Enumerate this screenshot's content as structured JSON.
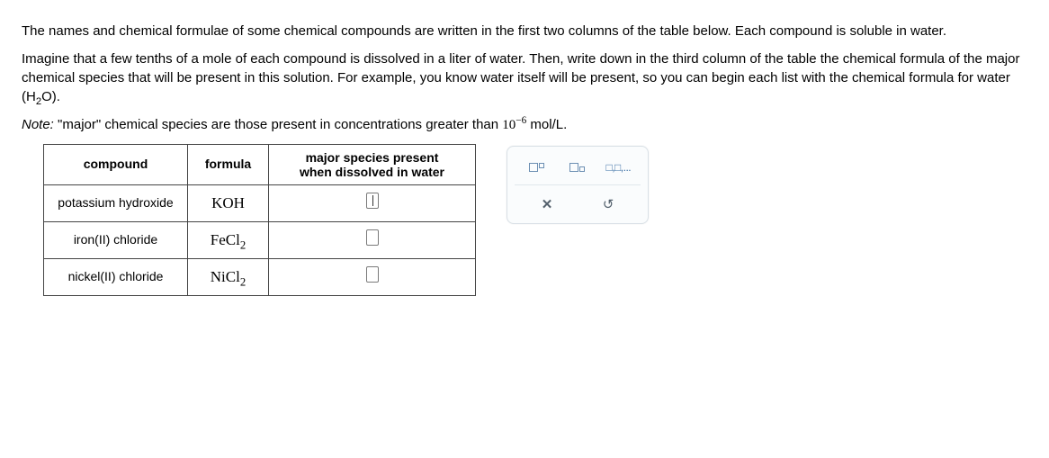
{
  "instructions": {
    "p1": "The names and chemical formulae of some chemical compounds are written in the first two columns of the table below. Each compound is soluble in water.",
    "p2_a": "Imagine that a few tenths of a mole of each compound is dissolved in a liter of water. Then, write down in the third column of the table the chemical formula of the major chemical species that will be present in this solution. For example, you know water itself will be present, so you can begin each list with the chemical formula for water (H",
    "p2_sub": "2",
    "p2_b": "O)."
  },
  "note": {
    "label": "Note:",
    "text_a": " \"major\" chemical species are those present in concentrations greater than ",
    "base": "10",
    "exp": "−6",
    "text_b": " mol/L."
  },
  "table": {
    "headers": {
      "compound": "compound",
      "formula": "formula",
      "species": "major species present\nwhen dissolved in water"
    },
    "rows": [
      {
        "name": "potassium hydroxide",
        "formula_plain": "KOH",
        "formula_sub": ""
      },
      {
        "name": "iron(II) chloride",
        "formula_plain": "FeCl",
        "formula_sub": "2"
      },
      {
        "name": "nickel(II) chloride",
        "formula_plain": "NiCl",
        "formula_sub": "2"
      }
    ]
  },
  "palette": {
    "tool_superscript": "superscript",
    "tool_subscript": "subscript",
    "tool_list": "□,□,...",
    "tool_clear": "clear",
    "tool_reset": "reset"
  }
}
